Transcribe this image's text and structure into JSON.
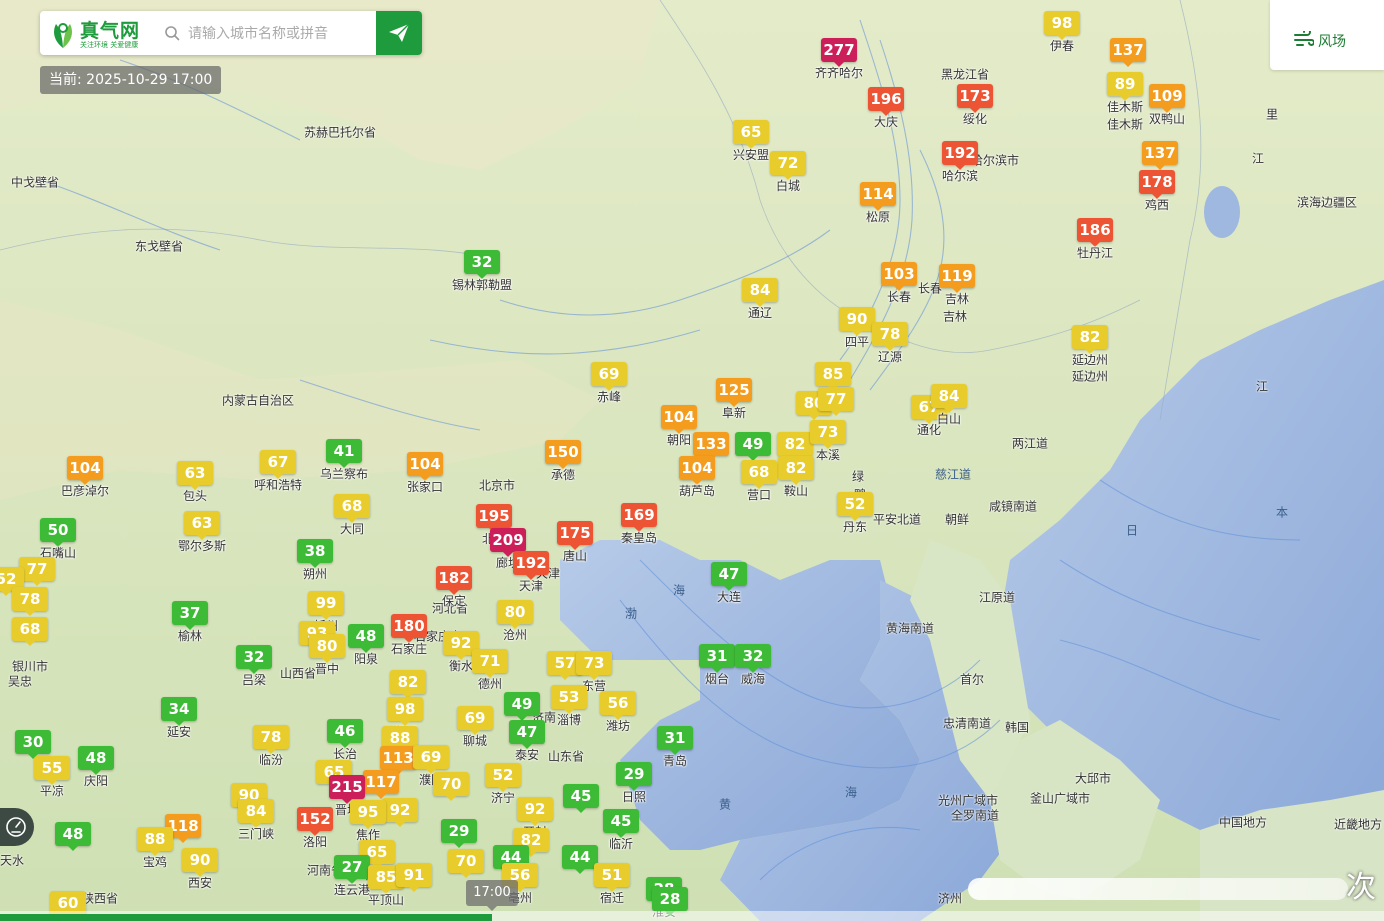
{
  "app": {
    "name": "真气网",
    "tagline": "关注环境 关爱健康"
  },
  "search": {
    "placeholder": "请输入城市名称或拼音",
    "value": ""
  },
  "timestamp_label": "当前: 2025-10-29 17:00",
  "wind_toggle_label": "风场",
  "timeline": {
    "current": "17:00"
  },
  "corner_text": "次",
  "aqi_colors": {
    "good": "#3dbb36",
    "moderate": "#e8cc2c",
    "sensitive": "#f39c1e",
    "unhealthy": "#ec5434",
    "very_unhealthy": "#cc1f59"
  },
  "stations": [
    {
      "city": "齐齐哈尔",
      "aqi": 277,
      "level": "very_unhealthy"
    },
    {
      "city": "大庆",
      "aqi": 196,
      "level": "unhealthy"
    },
    {
      "city": "绥化",
      "aqi": 173,
      "level": "unhealthy"
    },
    {
      "city": "哈尔滨",
      "aqi": 192,
      "level": "unhealthy"
    },
    {
      "city": "伊春",
      "aqi": 98,
      "level": "moderate"
    },
    {
      "city": "",
      "aqi": 137,
      "level": "sensitive"
    },
    {
      "city": "佳木斯",
      "aqi": 89,
      "level": "moderate"
    },
    {
      "city": "双鸭山",
      "aqi": 109,
      "level": "sensitive"
    },
    {
      "city": "",
      "aqi": 137,
      "level": "sensitive"
    },
    {
      "city": "鸡西",
      "aqi": 178,
      "level": "unhealthy"
    },
    {
      "city": "牡丹江",
      "aqi": 186,
      "level": "unhealthy"
    },
    {
      "city": "兴安盟",
      "aqi": 65,
      "level": "moderate"
    },
    {
      "city": "白城",
      "aqi": 72,
      "level": "moderate"
    },
    {
      "city": "松原",
      "aqi": 114,
      "level": "sensitive"
    },
    {
      "city": "锡林郭勒盟",
      "aqi": 32,
      "level": "good"
    },
    {
      "city": "通辽",
      "aqi": 84,
      "level": "moderate"
    },
    {
      "city": "长春",
      "aqi": 103,
      "level": "sensitive"
    },
    {
      "city": "吉林",
      "aqi": 119,
      "level": "sensitive"
    },
    {
      "city": "四平",
      "aqi": 90,
      "level": "moderate"
    },
    {
      "city": "辽源",
      "aqi": 78,
      "level": "moderate"
    },
    {
      "city": "延边州",
      "aqi": 82,
      "level": "moderate"
    },
    {
      "city": "赤峰",
      "aqi": 69,
      "level": "moderate"
    },
    {
      "city": "",
      "aqi": 85,
      "level": "moderate"
    },
    {
      "city": "阜新",
      "aqi": 125,
      "level": "sensitive"
    },
    {
      "city": "",
      "aqi": 80,
      "level": "moderate"
    },
    {
      "city": "",
      "aqi": 77,
      "level": "moderate"
    },
    {
      "city": "通化",
      "aqi": 67,
      "level": "moderate"
    },
    {
      "city": "白山",
      "aqi": 84,
      "level": "moderate"
    },
    {
      "city": "朝阳",
      "aqi": 104,
      "level": "sensitive"
    },
    {
      "city": "",
      "aqi": 133,
      "level": "sensitive"
    },
    {
      "city": "",
      "aqi": 49,
      "level": "good"
    },
    {
      "city": "",
      "aqi": 82,
      "level": "moderate"
    },
    {
      "city": "本溪",
      "aqi": 73,
      "level": "moderate"
    },
    {
      "city": "鞍山",
      "aqi": 82,
      "level": "moderate"
    },
    {
      "city": "葫芦岛",
      "aqi": 104,
      "level": "sensitive"
    },
    {
      "city": "营口",
      "aqi": 68,
      "level": "moderate"
    },
    {
      "city": "丹东",
      "aqi": 52,
      "level": "moderate"
    },
    {
      "city": "巴彦淖尔",
      "aqi": 104,
      "level": "sensitive"
    },
    {
      "city": "包头",
      "aqi": 63,
      "level": "moderate"
    },
    {
      "city": "呼和浩特",
      "aqi": 67,
      "level": "moderate"
    },
    {
      "city": "乌兰察布",
      "aqi": 41,
      "level": "good"
    },
    {
      "city": "张家口",
      "aqi": 104,
      "level": "sensitive"
    },
    {
      "city": "承德",
      "aqi": 150,
      "level": "sensitive"
    },
    {
      "city": "鄂尔多斯",
      "aqi": 63,
      "level": "moderate"
    },
    {
      "city": "大同",
      "aqi": 68,
      "level": "moderate"
    },
    {
      "city": "北京",
      "aqi": 195,
      "level": "unhealthy"
    },
    {
      "city": "廊坊",
      "aqi": 209,
      "level": "very_unhealthy"
    },
    {
      "city": "唐山",
      "aqi": 175,
      "level": "unhealthy"
    },
    {
      "city": "秦皇岛",
      "aqi": 169,
      "level": "unhealthy"
    },
    {
      "city": "天津",
      "aqi": 192,
      "level": "unhealthy"
    },
    {
      "city": "石嘴山",
      "aqi": 50,
      "level": "good"
    },
    {
      "city": "",
      "aqi": 77,
      "level": "moderate"
    },
    {
      "city": "",
      "aqi": 52,
      "level": "moderate"
    },
    {
      "city": "",
      "aqi": 78,
      "level": "moderate"
    },
    {
      "city": "",
      "aqi": 68,
      "level": "moderate"
    },
    {
      "city": "朔州",
      "aqi": 38,
      "level": "good"
    },
    {
      "city": "保定",
      "aqi": 182,
      "level": "unhealthy"
    },
    {
      "city": "大连",
      "aqi": 47,
      "level": "good"
    },
    {
      "city": "忻州",
      "aqi": 99,
      "level": "moderate"
    },
    {
      "city": "沧州",
      "aqi": 80,
      "level": "moderate"
    },
    {
      "city": "榆林",
      "aqi": 37,
      "level": "good"
    },
    {
      "city": "",
      "aqi": 93,
      "level": "moderate"
    },
    {
      "city": "晋中",
      "aqi": 80,
      "level": "moderate"
    },
    {
      "city": "阳泉",
      "aqi": 48,
      "level": "good"
    },
    {
      "city": "石家庄",
      "aqi": 180,
      "level": "unhealthy"
    },
    {
      "city": "衡水",
      "aqi": 92,
      "level": "moderate"
    },
    {
      "city": "德州",
      "aqi": 71,
      "level": "moderate"
    },
    {
      "city": "",
      "aqi": 57,
      "level": "moderate"
    },
    {
      "city": "东营",
      "aqi": 73,
      "level": "moderate"
    },
    {
      "city": "烟台",
      "aqi": 31,
      "level": "good"
    },
    {
      "city": "威海",
      "aqi": 32,
      "level": "good"
    },
    {
      "city": "吕梁",
      "aqi": 32,
      "level": "good"
    },
    {
      "city": "邢台",
      "aqi": 82,
      "level": "moderate"
    },
    {
      "city": "淄博",
      "aqi": 53,
      "level": "moderate"
    },
    {
      "city": "潍坊",
      "aqi": 56,
      "level": "moderate"
    },
    {
      "city": "延安",
      "aqi": 34,
      "level": "good"
    },
    {
      "city": "邯郸",
      "aqi": 98,
      "level": "moderate"
    },
    {
      "city": "聊城",
      "aqi": 69,
      "level": "moderate"
    },
    {
      "city": "济南",
      "aqi": 49,
      "level": "good"
    },
    {
      "city": "泰安",
      "aqi": 47,
      "level": "good"
    },
    {
      "city": "长治",
      "aqi": 46,
      "level": "good"
    },
    {
      "city": "",
      "aqi": 88,
      "level": "moderate"
    },
    {
      "city": "青岛",
      "aqi": 31,
      "level": "good"
    },
    {
      "city": "",
      "aqi": 30,
      "level": "good"
    },
    {
      "city": "平凉",
      "aqi": 55,
      "level": "moderate"
    },
    {
      "city": "庆阳",
      "aqi": 48,
      "level": "good"
    },
    {
      "city": "临汾",
      "aqi": 78,
      "level": "moderate"
    },
    {
      "city": "",
      "aqi": 113,
      "level": "sensitive"
    },
    {
      "city": "濮阳",
      "aqi": 69,
      "level": "moderate"
    },
    {
      "city": "",
      "aqi": 65,
      "level": "moderate"
    },
    {
      "city": "",
      "aqi": 117,
      "level": "sensitive"
    },
    {
      "city": "",
      "aqi": 70,
      "level": "moderate"
    },
    {
      "city": "济宁",
      "aqi": 52,
      "level": "moderate"
    },
    {
      "city": "日照",
      "aqi": 29,
      "level": "good"
    },
    {
      "city": "晋城",
      "aqi": 215,
      "level": "very_unhealthy"
    },
    {
      "city": "",
      "aqi": 90,
      "level": "moderate"
    },
    {
      "city": "",
      "aqi": 92,
      "level": "moderate"
    },
    {
      "city": "三门峡",
      "aqi": 84,
      "level": "moderate"
    },
    {
      "city": "",
      "aqi": 118,
      "level": "sensitive"
    },
    {
      "city": "洛阳",
      "aqi": 152,
      "level": "unhealthy"
    },
    {
      "city": "焦作",
      "aqi": 95,
      "level": "moderate"
    },
    {
      "city": "开封",
      "aqi": 92,
      "level": "moderate"
    },
    {
      "city": "",
      "aqi": 45,
      "level": "good"
    },
    {
      "city": "临沂",
      "aqi": 45,
      "level": "good"
    },
    {
      "city": "",
      "aqi": 29,
      "level": "good"
    },
    {
      "city": "",
      "aqi": 48,
      "level": "good"
    },
    {
      "city": "宝鸡",
      "aqi": 88,
      "level": "moderate"
    },
    {
      "city": "西安",
      "aqi": 90,
      "level": "moderate"
    },
    {
      "city": "商洛",
      "aqi": 65,
      "level": "moderate"
    },
    {
      "city": "",
      "aqi": 82,
      "level": "moderate"
    },
    {
      "city": "",
      "aqi": 44,
      "level": "good"
    },
    {
      "city": "",
      "aqi": 44,
      "level": "good"
    },
    {
      "city": "连云港",
      "aqi": 27,
      "level": "good"
    },
    {
      "city": "平顶山",
      "aqi": 85,
      "level": "moderate"
    },
    {
      "city": "",
      "aqi": 91,
      "level": "moderate"
    },
    {
      "city": "",
      "aqi": 70,
      "level": "moderate"
    },
    {
      "city": "亳州",
      "aqi": 56,
      "level": "moderate"
    },
    {
      "city": "宿迁",
      "aqi": 51,
      "level": "moderate"
    },
    {
      "city": "淮安",
      "aqi": 28,
      "level": "good"
    },
    {
      "city": "",
      "aqi": 28,
      "level": "good"
    },
    {
      "city": "",
      "aqi": 60,
      "level": "moderate"
    }
  ],
  "places": [
    "苏赫巴托尔省",
    "中戈壁省",
    "东戈壁省",
    "内蒙古自治区",
    "黑龙江省",
    "佳木斯",
    "里",
    "江",
    "滨海边疆区",
    "哈尔滨市",
    "长春",
    "吉林",
    "江",
    "延边州",
    "两江道",
    "慈江道",
    "咸镜南道",
    "朝鲜",
    "平安北道",
    "绿",
    "鸭",
    "日",
    "本",
    "江原道",
    "黄海南道",
    "首尔",
    "忠清南道",
    "韩国",
    "大邱市",
    "釜山广域市",
    "光州广域市",
    "全罗南道",
    "中国地方",
    "近畿地方",
    "济州",
    "渤",
    "海",
    "黄",
    "海",
    "北京市",
    "天津",
    "河北省",
    "石家庄市",
    "山东省",
    "山西省",
    "济南",
    "银川市",
    "吴忠",
    "天水",
    "陕西省",
    "河南省"
  ]
}
